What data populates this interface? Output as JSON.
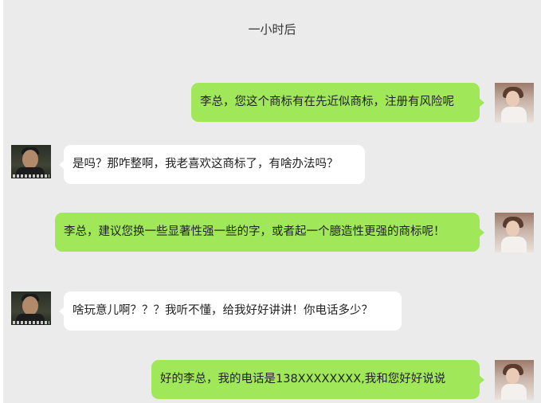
{
  "time_divider": "一小时后",
  "messages": [
    {
      "side": "out",
      "text": "李总，您这个商标有在先近似商标，注册有风险呢"
    },
    {
      "side": "in",
      "text": "是吗？那咋整啊，我老喜欢这商标了，有啥办法吗？"
    },
    {
      "side": "out",
      "text": "李总，建议您换一些显著性强一些的字，或者起一个臆造性更强的商标呢！"
    },
    {
      "side": "in",
      "text": "啥玩意儿啊？？？我听不懂，给我好好讲讲！你电话多少？"
    },
    {
      "side": "out",
      "text": "好的李总，我的电话是138XXXXXXXX,我和您好好说说"
    }
  ],
  "colors": {
    "background": "#ebebeb",
    "outgoing_bubble": "#a0e75a",
    "incoming_bubble": "#ffffff"
  }
}
